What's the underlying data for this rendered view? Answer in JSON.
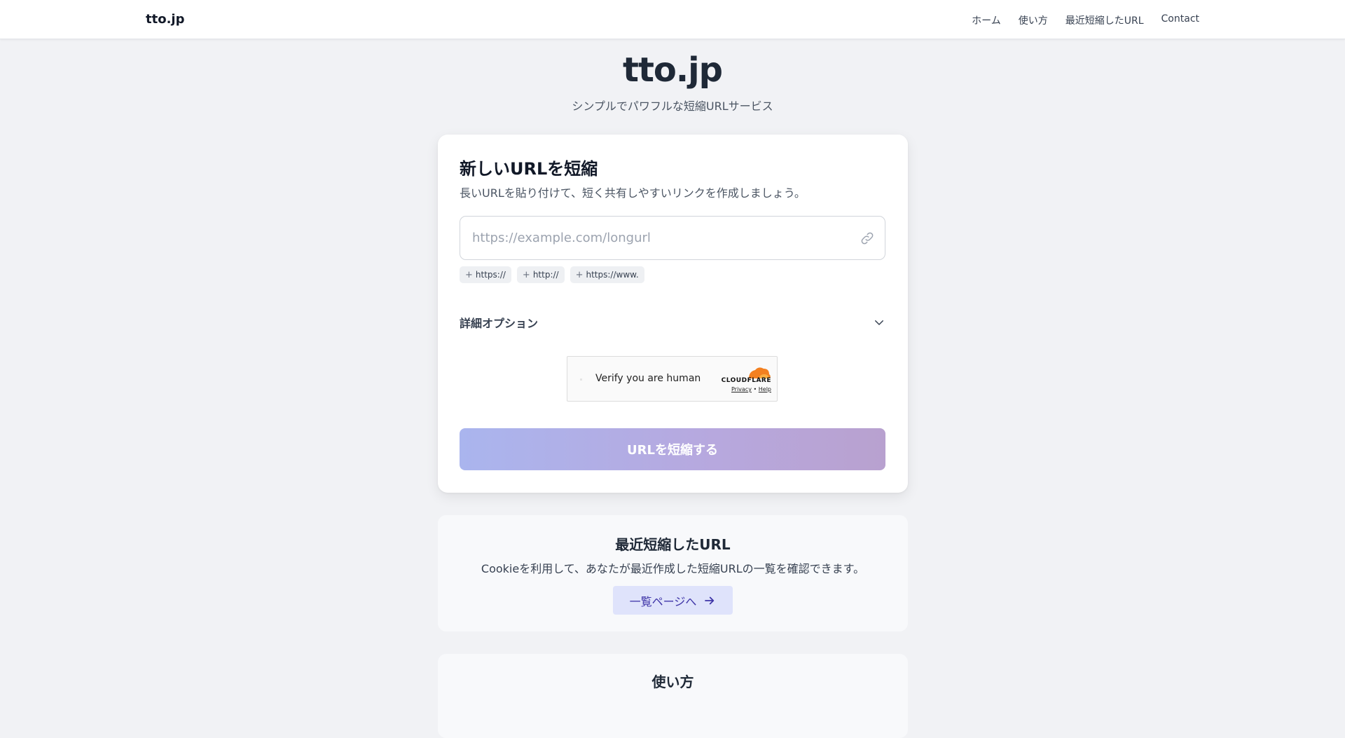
{
  "header": {
    "brand": "tto.jp",
    "nav": [
      "ホーム",
      "使い方",
      "最近短縮したURL",
      "Contact"
    ]
  },
  "hero": {
    "title": "tto.jp",
    "subtitle": "シンプルでパワフルな短縮URLサービス"
  },
  "form": {
    "title": "新しいURLを短縮",
    "description": "長いURLを貼り付けて、短く共有しやすいリンクを作成しましょう。",
    "url_placeholder": "https://example.com/longurl",
    "url_value": "",
    "prefix_chips": [
      "https://",
      "http://",
      "https://www."
    ],
    "advanced_label": "詳細オプション",
    "submit_label": "URLを短縮する"
  },
  "captcha": {
    "label": "Verify you are human",
    "provider": "CLOUDFLARE",
    "privacy": "Privacy",
    "separator": "•",
    "help": "Help"
  },
  "recent": {
    "title": "最近短縮したURL",
    "description": "Cookieを利用して、あなたが最近作成した短縮URLの一覧を確認できます。",
    "button_label": "一覧ページへ"
  },
  "howto": {
    "title": "使い方"
  },
  "colors": {
    "accent": "#3f35a8",
    "button_gradient_start": "#aab5ee",
    "button_gradient_end": "#b8a1cf",
    "cloudflare_orange": "#f38020"
  }
}
